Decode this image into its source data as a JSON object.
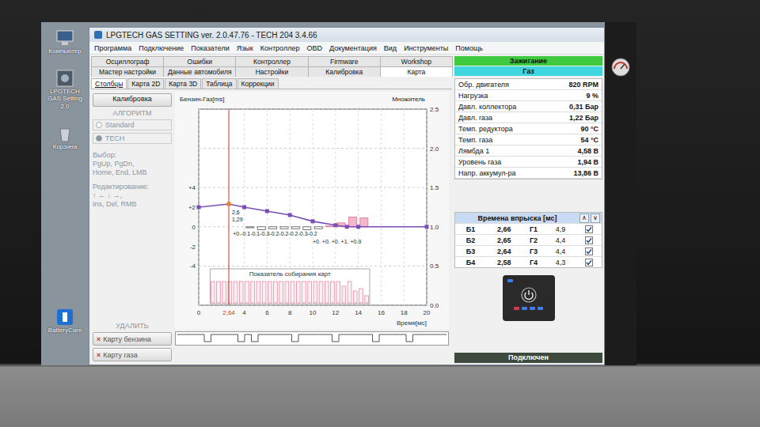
{
  "desktop": {
    "icons": [
      {
        "label": "Компьютер",
        "kind": "computer"
      },
      {
        "label": "LPGTECH GAS Setting 2.0",
        "kind": "app"
      },
      {
        "label": "Корзина",
        "kind": "trash"
      },
      {
        "label": "BatteryCare",
        "kind": "battery"
      }
    ]
  },
  "window": {
    "title": "LPGTECH GAS SETTING ver. 2.0.47.76 - TECH 204   3.4.66"
  },
  "menu": [
    "Программа",
    "Подключение",
    "Показатели",
    "Язык",
    "Контроллер",
    "OBD",
    "Документация",
    "Вид",
    "Инструменты",
    "Помощь"
  ],
  "tabs_row1": [
    {
      "label": "Осциллограф",
      "selected": false
    },
    {
      "label": "Ошибки",
      "selected": false
    },
    {
      "label": "Контроллер",
      "selected": false
    },
    {
      "label": "Firmware",
      "selected": false
    },
    {
      "label": "Workshop",
      "selected": false
    }
  ],
  "tabs_row2": [
    {
      "label": "Мастер настройки",
      "selected": false
    },
    {
      "label": "Данные автомобиля",
      "selected": false
    },
    {
      "label": "Настройки",
      "selected": false
    },
    {
      "label": "Калибровка",
      "selected": false
    },
    {
      "label": "Карта",
      "selected": true
    }
  ],
  "subtabs": [
    {
      "label": "Столбцы",
      "selected": true
    },
    {
      "label": "Карта 2D",
      "selected": false
    },
    {
      "label": "Карта 3D",
      "selected": false
    },
    {
      "label": "Таблица",
      "selected": false
    },
    {
      "label": "Коррекции",
      "selected": false
    }
  ],
  "left_panel": {
    "calibration_button": "Калибровка",
    "algorithm_title": "АЛГОРИТМ",
    "algorithms": [
      {
        "label": "Standard",
        "selected": false
      },
      {
        "label": "TECH",
        "selected": true
      }
    ],
    "help_groups": [
      [
        "Выбор:",
        "PgUp, PgDn,",
        "Home, End, LMB"
      ],
      [
        "Редактирование:",
        "↑ ← ↓ →,",
        "Ins, Del, RMB"
      ]
    ],
    "delete_title": "УДАЛИТЬ",
    "delete_buttons": [
      {
        "icon": "×",
        "label": "Карту бензина"
      },
      {
        "icon": "×",
        "label": "Карту газа"
      }
    ]
  },
  "chart": {
    "title": "Бензин-Газ[ms]",
    "right_title": "Множитель",
    "left_ticks": [
      {
        "label": "+4",
        "value": 4
      },
      {
        "label": "+2",
        "value": 2
      },
      {
        "label": "0",
        "value": 0
      },
      {
        "label": "-2",
        "value": -2
      },
      {
        "label": "-4",
        "value": -4
      }
    ],
    "right_ticks": [
      {
        "label": "2.5",
        "value": 2.5
      },
      {
        "label": "2.0",
        "value": 2.0
      },
      {
        "label": "1.5",
        "value": 1.5
      },
      {
        "label": "1.0",
        "value": 1.0
      },
      {
        "label": "0.5",
        "value": 0.5
      },
      {
        "label": "0.0",
        "value": 0.0
      }
    ],
    "x_ticks": [
      {
        "label": "0",
        "x": 0
      },
      {
        "label": "4",
        "x": 4
      },
      {
        "label": "6",
        "x": 6
      },
      {
        "label": "8",
        "x": 8
      },
      {
        "label": "10",
        "x": 10
      },
      {
        "label": "12",
        "x": 12
      },
      {
        "label": "14",
        "x": 14
      },
      {
        "label": "16",
        "x": 16
      },
      {
        "label": "18",
        "x": 18
      },
      {
        "label": "20",
        "x": 20
      }
    ],
    "x_label": "Время[мс]",
    "cursor": {
      "x": 2.64,
      "label": "2,64",
      "value_labels": [
        "2,6",
        "1,29"
      ]
    },
    "multiplier": [
      [
        0,
        1.25
      ],
      [
        2.64,
        1.29
      ],
      [
        4,
        1.25
      ],
      [
        6,
        1.2
      ],
      [
        8,
        1.15
      ],
      [
        10,
        1.07
      ],
      [
        12,
        1.02
      ],
      [
        13,
        1.0
      ],
      [
        14,
        1.0
      ],
      [
        20,
        1.0
      ]
    ],
    "diff_bars": [
      {
        "x": 4.5,
        "value": -0.1
      },
      {
        "x": 5.5,
        "value": -0.3
      },
      {
        "x": 6.5,
        "value": -0.2
      },
      {
        "x": 7.5,
        "value": -0.2
      },
      {
        "x": 8.5,
        "value": -0.2
      },
      {
        "x": 9.5,
        "value": -0.3
      },
      {
        "x": 10.5,
        "value": -0.2
      },
      {
        "x": 11.5,
        "value": 0.1
      },
      {
        "x": 12.5,
        "value": 0.4
      },
      {
        "x": 13.5,
        "value": 1.0
      },
      {
        "x": 14.5,
        "value": 0.9
      }
    ],
    "diff_labels": [
      "+0.-0.1-0.1-0.3-0.2-0.2-0.2-0.3-0.2",
      "+0. +0. +0. +1. +0.9"
    ],
    "collection": {
      "title": "Показатель собирания карт",
      "levels": [
        0.9,
        0.9,
        0.9,
        0.9,
        0.9,
        0.9,
        0.9,
        0.9,
        0.9,
        0.9,
        0.9,
        0.9,
        0.9,
        0.9,
        0.9,
        0.9,
        0.9,
        0.9,
        0.9,
        0.9,
        0.9,
        0.9,
        0.9,
        0.7,
        0.9,
        0.5,
        0.6,
        0.3
      ]
    },
    "waveform": [
      1,
      1,
      1,
      1,
      0,
      1,
      1,
      1,
      1,
      0,
      1,
      0,
      1,
      1,
      1,
      1,
      1,
      0,
      1,
      1,
      1,
      1,
      1,
      0,
      1,
      1,
      1,
      1,
      1,
      0,
      1,
      1,
      1,
      1,
      0,
      1,
      1,
      1,
      1,
      1
    ]
  },
  "status": [
    {
      "label": "Зажигание",
      "color": "#3ec93e"
    },
    {
      "label": "Газ",
      "color": "#3fd6e0"
    }
  ],
  "readings": [
    {
      "label": "Обр. двигателя",
      "value": "820 RPM"
    },
    {
      "label": "Нагрузка",
      "value": "9 %"
    },
    {
      "label": "Давл. коллектора",
      "value": "0,31 Бар"
    },
    {
      "label": "Давл. газа",
      "value": "1,22 Бар"
    },
    {
      "label": "Темп. редуктора",
      "value": "90 °C"
    },
    {
      "label": "Темп. газа",
      "value": "54 °C"
    },
    {
      "label": "Лямбда 1",
      "value": "4,58 В"
    },
    {
      "label": "Уровень газа",
      "value": "1,94 В"
    },
    {
      "label": "Напр. аккумул-ра",
      "value": "13,86 В"
    }
  ],
  "injection": {
    "title": "Времена впрыска [мс]",
    "buttons": [
      "∧",
      "∨"
    ],
    "rows": [
      {
        "b": "Б1",
        "b_value": "2,66",
        "g": "Г1",
        "g_value": "4,9",
        "checked": true
      },
      {
        "b": "Б2",
        "b_value": "2,65",
        "g": "Г2",
        "g_value": "4,4",
        "checked": true
      },
      {
        "b": "Б3",
        "b_value": "2,64",
        "g": "Г3",
        "g_value": "4,4",
        "checked": true
      },
      {
        "b": "Б4",
        "b_value": "2,58",
        "g": "Г4",
        "g_value": "4,3",
        "checked": true
      }
    ]
  },
  "switch": {
    "top_led": {
      "color": "#3a7bff"
    },
    "leds": [
      {
        "color": "#e0344a"
      },
      {
        "color": "#3a7bff"
      },
      {
        "color": "#3a7bff"
      },
      {
        "color": "#3a7bff"
      }
    ]
  },
  "status_bar": "Подключен"
}
